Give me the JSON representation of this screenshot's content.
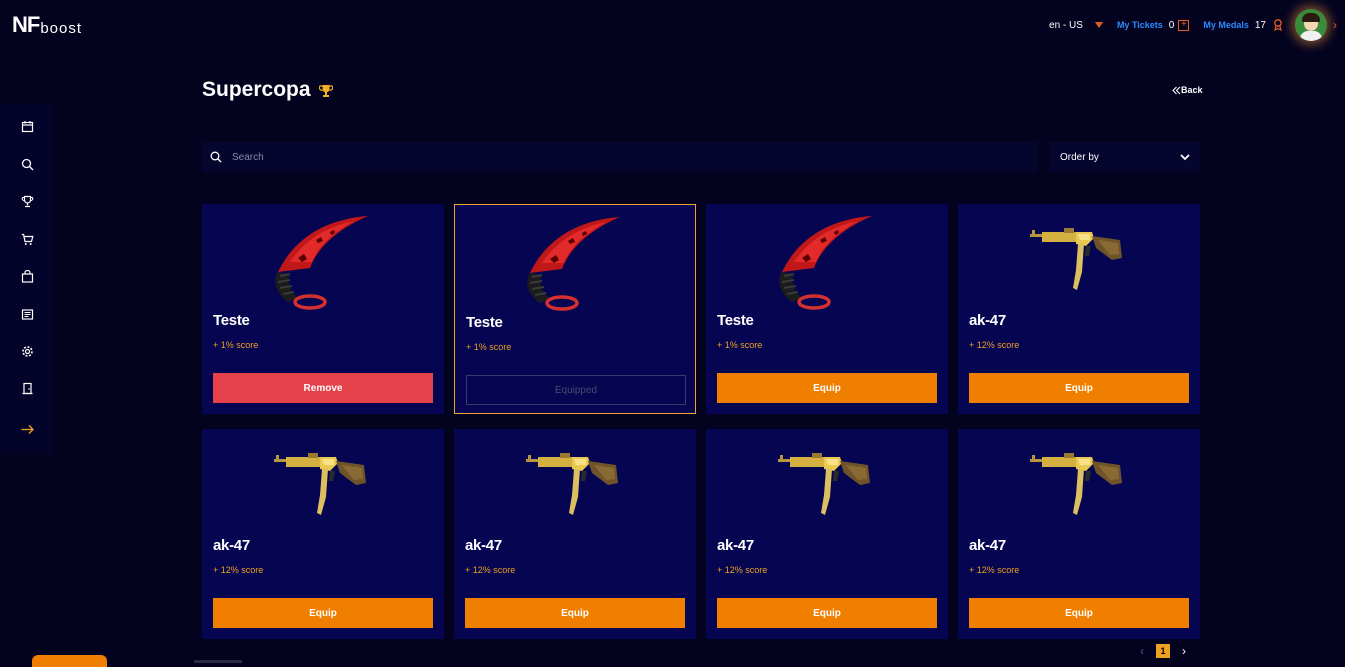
{
  "header": {
    "logo_main": "NF",
    "logo_sub": "boost",
    "language": "en - US",
    "tickets_label": "My Tickets",
    "tickets_count": "0",
    "medals_label": "My Medals",
    "medals_count": "17"
  },
  "sidebar": {
    "icons": [
      "calendar-icon",
      "search-icon",
      "trophy-icon",
      "cart-icon",
      "bag-icon",
      "news-icon",
      "gear-icon",
      "door-icon",
      "arrow-right-icon"
    ]
  },
  "page": {
    "title": "Supercopa",
    "back_label": "Back",
    "search_placeholder": "Search",
    "order_by_label": "Order by"
  },
  "items": [
    {
      "name": "Teste",
      "bonus": "+ 1% score",
      "image": "karambit-knife",
      "action": "Remove",
      "state": "remove"
    },
    {
      "name": "Teste",
      "bonus": "+ 1% score",
      "image": "karambit-knife",
      "action": "Equipped",
      "state": "equipped"
    },
    {
      "name": "Teste",
      "bonus": "+ 1% score",
      "image": "karambit-knife",
      "action": "Equip",
      "state": "equip"
    },
    {
      "name": "ak-47",
      "bonus": "+ 12% score",
      "image": "gold-ak47",
      "action": "Equip",
      "state": "equip"
    },
    {
      "name": "ak-47",
      "bonus": "+ 12% score",
      "image": "gold-ak47",
      "action": "Equip",
      "state": "equip"
    },
    {
      "name": "ak-47",
      "bonus": "+ 12% score",
      "image": "gold-ak47",
      "action": "Equip",
      "state": "equip"
    },
    {
      "name": "ak-47",
      "bonus": "+ 12% score",
      "image": "gold-ak47",
      "action": "Equip",
      "state": "equip"
    },
    {
      "name": "ak-47",
      "bonus": "+ 12% score",
      "image": "gold-ak47",
      "action": "Equip",
      "state": "equip"
    }
  ],
  "pagination": {
    "current": "1"
  },
  "colors": {
    "accent": "#f07f00",
    "remove": "#e5414a",
    "link": "#2a8bff",
    "background": "#03031f",
    "card": "#050552"
  }
}
